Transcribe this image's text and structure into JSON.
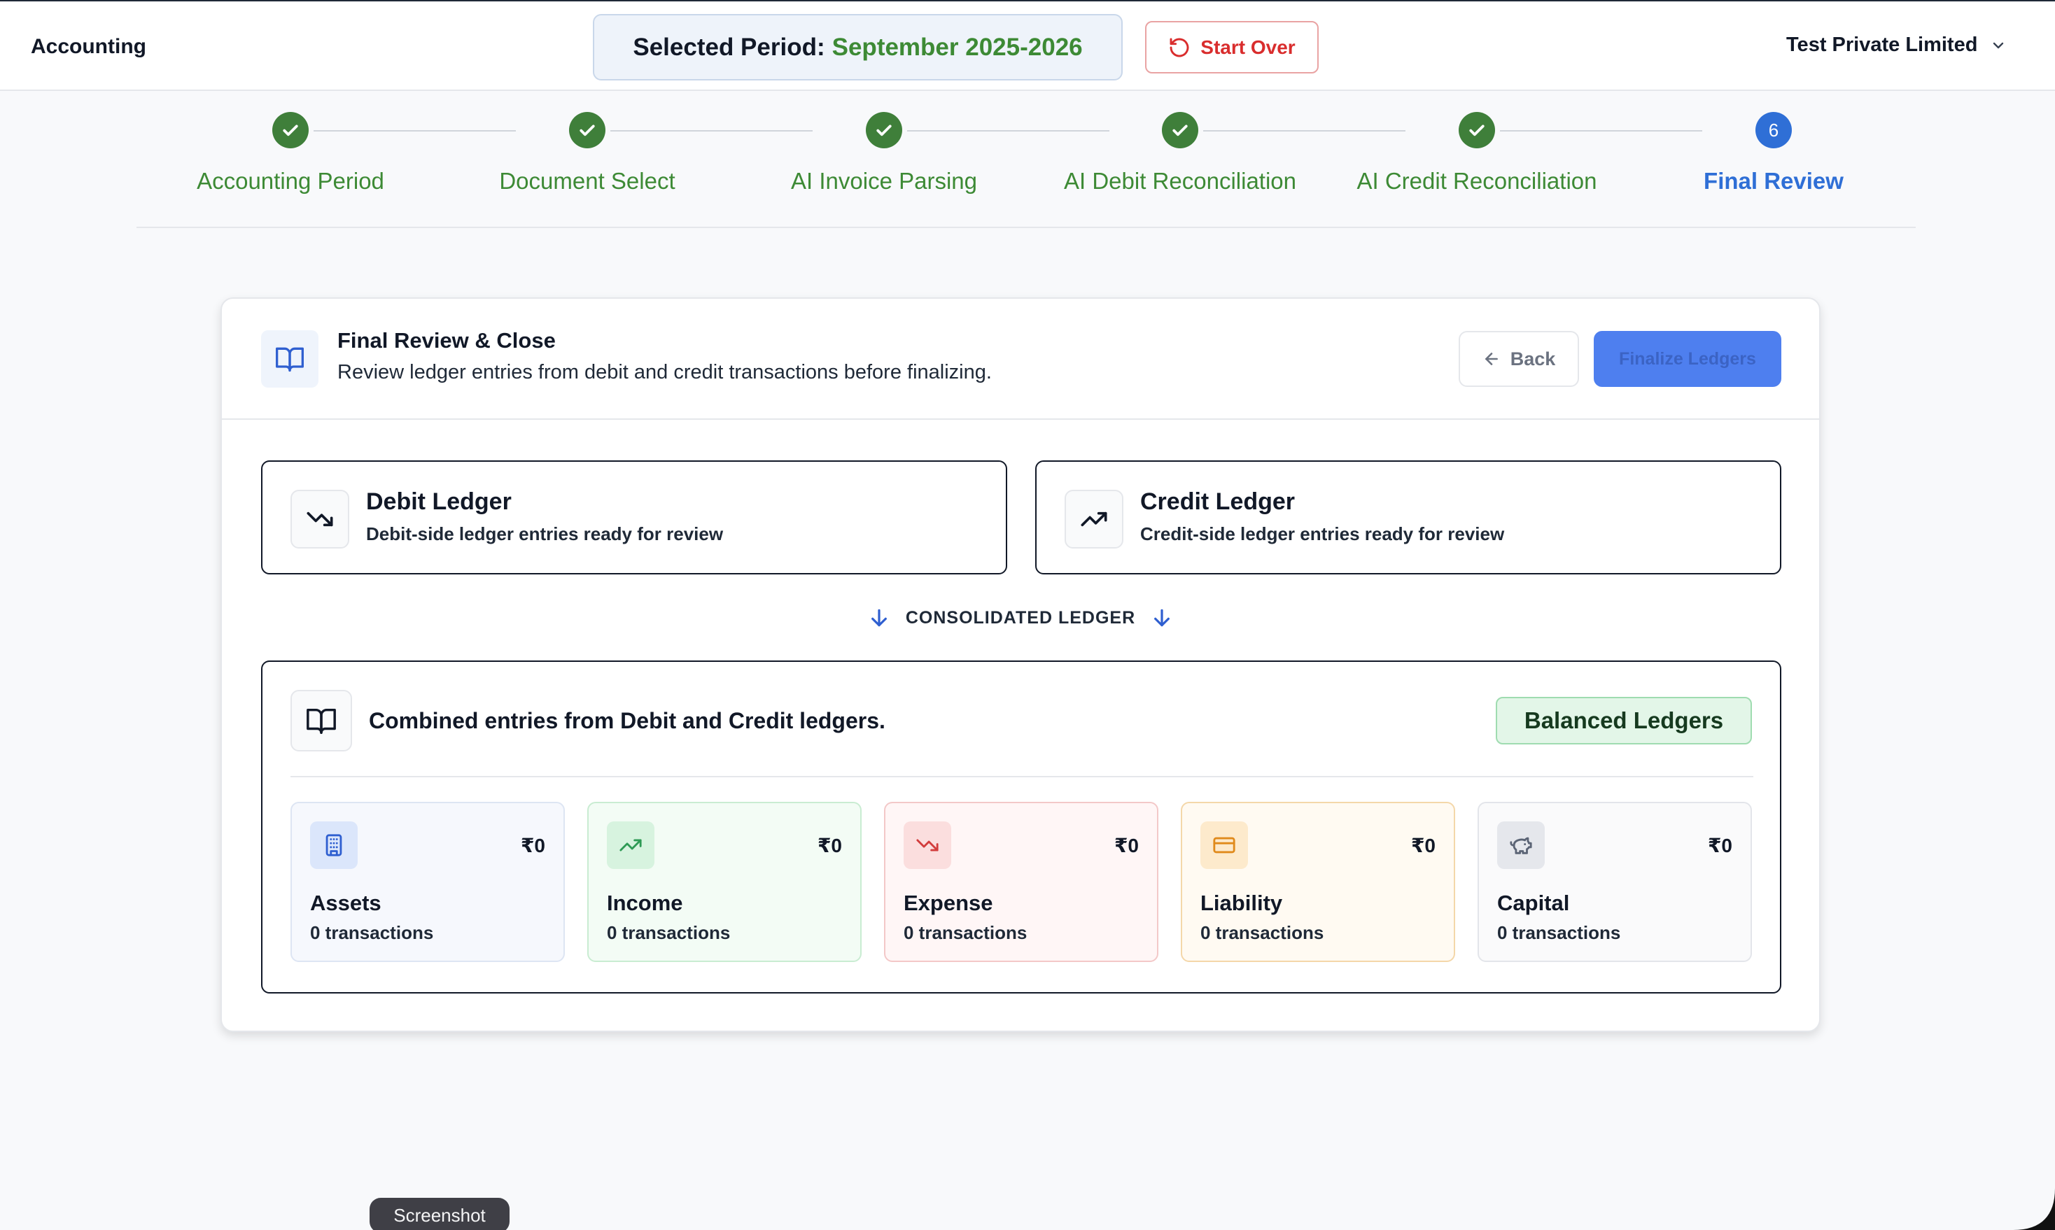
{
  "header": {
    "app_title": "Accounting",
    "period_label": "Selected Period:",
    "period_value": "September 2025-2026",
    "start_over_label": "Start Over",
    "company_name": "Test Private Limited"
  },
  "stepper": {
    "steps": [
      {
        "label": "Accounting Period",
        "status": "complete"
      },
      {
        "label": "Document Select",
        "status": "complete"
      },
      {
        "label": "AI Invoice Parsing",
        "status": "complete"
      },
      {
        "label": "AI Debit Reconciliation",
        "status": "complete"
      },
      {
        "label": "AI Credit Reconciliation",
        "status": "complete"
      },
      {
        "label": "Final Review",
        "status": "current",
        "number": "6"
      }
    ]
  },
  "review": {
    "title": "Final Review & Close",
    "subtitle": "Review ledger entries from debit and credit transactions before finalizing.",
    "back_label": "Back",
    "finalize_label": "Finalize Ledgers"
  },
  "ledgers": {
    "debit": {
      "title": "Debit Ledger",
      "subtitle": "Debit-side ledger entries ready for review"
    },
    "credit": {
      "title": "Credit Ledger",
      "subtitle": "Credit-side ledger entries ready for review"
    }
  },
  "consolidated": {
    "label": "CONSOLIDATED LEDGER",
    "title": "Combined entries from Debit and Credit ledgers.",
    "badge": "Balanced Ledgers",
    "stats": [
      {
        "name": "Assets",
        "amount": "₹0",
        "count": "0 transactions",
        "icon": "building-icon",
        "bg": "#f6f8fd",
        "border": "#dde5f3",
        "icon_bg": "#dbe6fb",
        "icon_color": "#2f5fd0"
      },
      {
        "name": "Income",
        "amount": "₹0",
        "count": "0 transactions",
        "icon": "trending-up-icon",
        "bg": "#f3fcf5",
        "border": "#c9ecd2",
        "icon_bg": "#d7f3df",
        "icon_color": "#2e9a55"
      },
      {
        "name": "Expense",
        "amount": "₹0",
        "count": "0 transactions",
        "icon": "trending-down-icon",
        "bg": "#fff6f6",
        "border": "#f3c8c8",
        "icon_bg": "#fbdede",
        "icon_color": "#d23c3c"
      },
      {
        "name": "Liability",
        "amount": "₹0",
        "count": "0 transactions",
        "icon": "credit-card-icon",
        "bg": "#fffaf2",
        "border": "#f4d7a9",
        "icon_bg": "#fdeacc",
        "icon_color": "#e08a1b"
      },
      {
        "name": "Capital",
        "amount": "₹0",
        "count": "0 transactions",
        "icon": "piggy-bank-icon",
        "bg": "#fafafb",
        "border": "#e3e5ea",
        "icon_bg": "#e5e7ec",
        "icon_color": "#5b6475"
      }
    ]
  },
  "tooltip": "Screenshot"
}
